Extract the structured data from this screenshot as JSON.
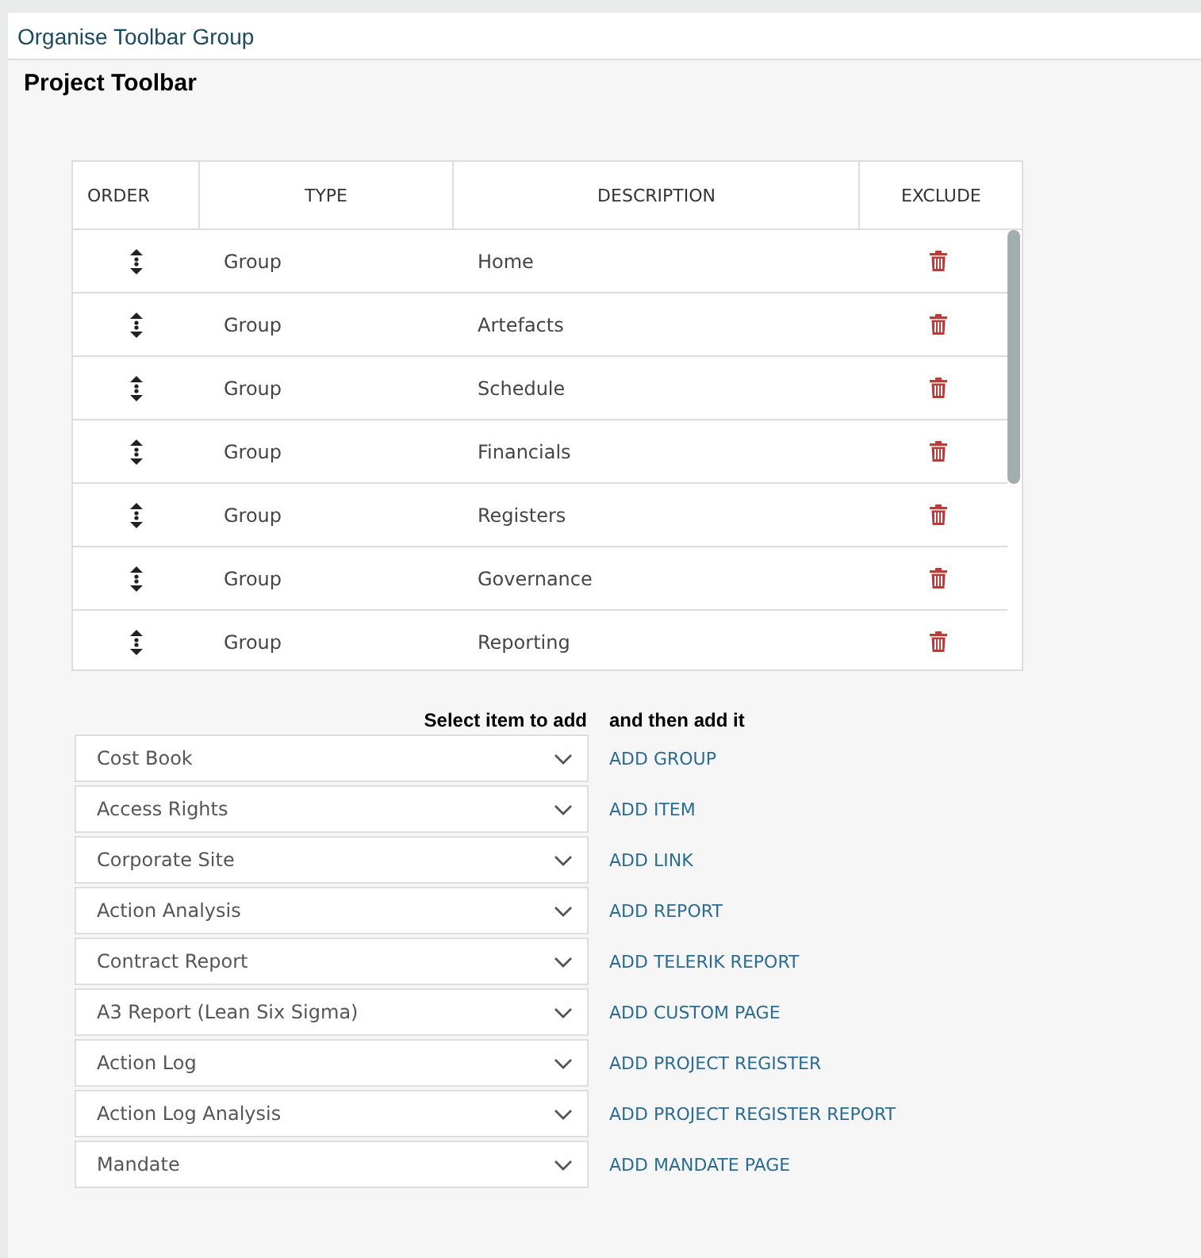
{
  "dialog": {
    "title": "Organise Toolbar Group",
    "heading": "Project Toolbar"
  },
  "table": {
    "columns": [
      "ORDER",
      "TYPE",
      "DESCRIPTION",
      "EXCLUDE"
    ],
    "rows": [
      {
        "type": "Group",
        "description": "Home"
      },
      {
        "type": "Group",
        "description": "Artefacts"
      },
      {
        "type": "Group",
        "description": "Schedule"
      },
      {
        "type": "Group",
        "description": "Financials"
      },
      {
        "type": "Group",
        "description": "Registers"
      },
      {
        "type": "Group",
        "description": "Governance"
      },
      {
        "type": "Group",
        "description": "Reporting"
      }
    ]
  },
  "add_section": {
    "select_label": "Select item to add",
    "action_label": "and then add it",
    "rows": [
      {
        "value": "Cost Book",
        "action": "ADD GROUP"
      },
      {
        "value": "Access Rights",
        "action": "ADD ITEM"
      },
      {
        "value": "Corporate Site",
        "action": "ADD LINK"
      },
      {
        "value": "Action Analysis",
        "action": "ADD REPORT"
      },
      {
        "value": "Contract Report",
        "action": "ADD TELERIK REPORT"
      },
      {
        "value": "A3 Report (Lean Six Sigma)",
        "action": "ADD CUSTOM PAGE"
      },
      {
        "value": "Action Log",
        "action": "ADD PROJECT REGISTER"
      },
      {
        "value": "Action Log Analysis",
        "action": "ADD PROJECT REGISTER REPORT"
      },
      {
        "value": "Mandate",
        "action": "ADD MANDATE PAGE"
      }
    ]
  }
}
